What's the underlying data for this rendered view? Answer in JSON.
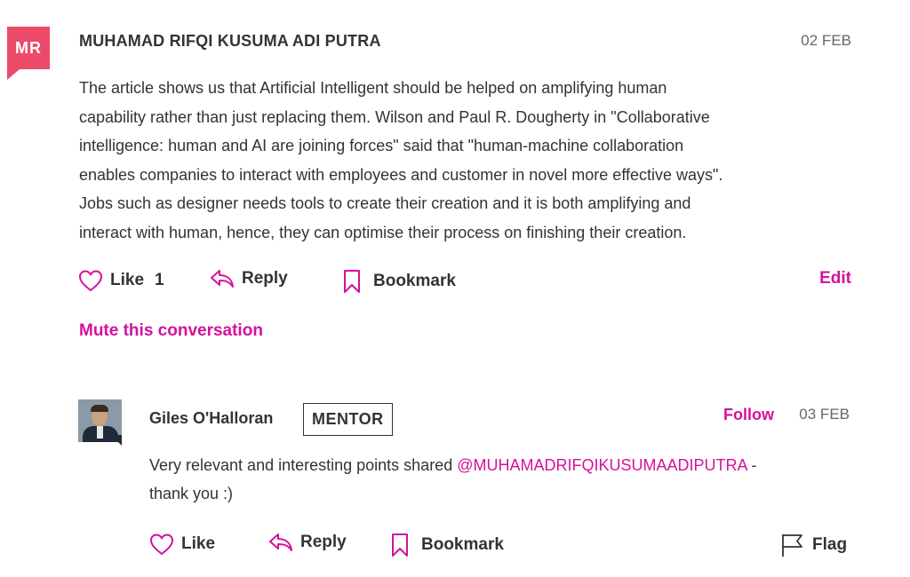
{
  "comment": {
    "initials": "MR",
    "author": "MUHAMAD RIFQI KUSUMA ADI PUTRA",
    "date": "02 FEB",
    "lines": [
      "The article shows us that Artificial Intelligent should be helped on amplifying human",
      "capability rather than just replacing them. Wilson and Paul R. Dougherty in \"Collaborative",
      "intelligence: human and AI are joining forces\" said that \"human-machine collaboration",
      "enables companies to interact with employees and customer in novel more effective ways\".",
      "Jobs such as designer needs tools to create their creation and it is both amplifying and",
      "interact with human, hence, they can optimise their process on finishing their creation."
    ],
    "actions": {
      "like_label": "Like",
      "like_count": "1",
      "reply_label": "Reply",
      "bookmark_label": "Bookmark",
      "edit_label": "Edit"
    },
    "mute_label": "Mute this conversation"
  },
  "reply": {
    "author": "Giles O'Halloran",
    "badge": "MENTOR",
    "follow_label": "Follow",
    "date": "03 FEB",
    "text_before": "Very relevant and interesting points shared ",
    "mention": "@MUHAMADRIFQIKUSUMAADIPUTRA",
    "text_after": " -",
    "line2": "thank you :)",
    "actions": {
      "like_label": "Like",
      "reply_label": "Reply",
      "bookmark_label": "Bookmark",
      "flag_label": "Flag"
    }
  },
  "colors": {
    "accent": "#d5109b",
    "avatar_bg": "#ec4a6a",
    "text": "#333333",
    "muted": "#666666"
  },
  "icons": [
    "heart-icon",
    "reply-arrow-icon",
    "bookmark-icon",
    "flag-icon"
  ]
}
